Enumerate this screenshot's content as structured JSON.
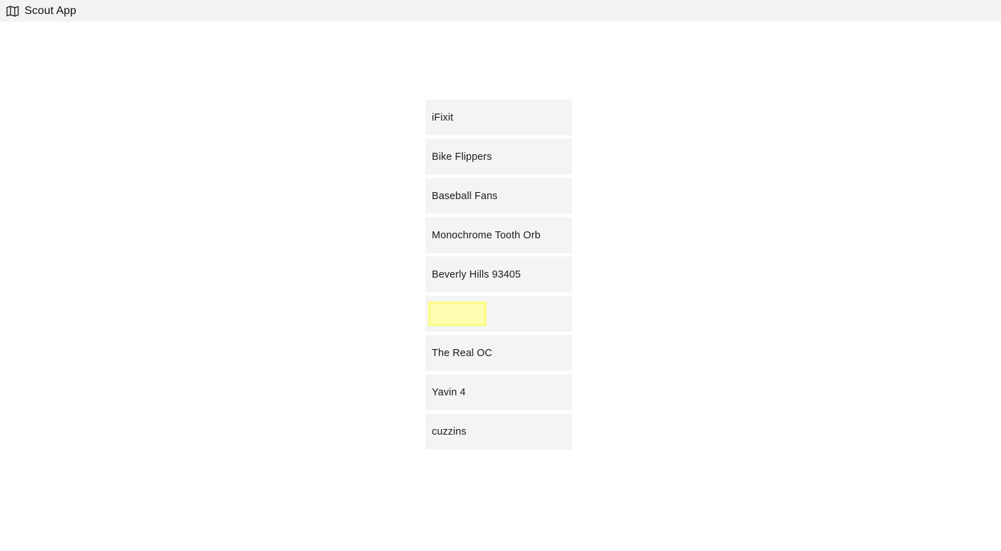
{
  "appbar": {
    "icon": "map-icon",
    "title": "Scout App"
  },
  "list": {
    "name": "scout-results-list",
    "items": [
      {
        "label": "iFixit",
        "highlighted": false
      },
      {
        "label": "Bike Flippers",
        "highlighted": false
      },
      {
        "label": "Baseball Fans",
        "highlighted": false
      },
      {
        "label": "Monochrome Tooth Orb",
        "highlighted": false
      },
      {
        "label": "Beverly Hills 93405",
        "highlighted": false
      },
      {
        "label": "",
        "highlighted": true
      },
      {
        "label": "The Real OC",
        "highlighted": false
      },
      {
        "label": "Yavin 4",
        "highlighted": false
      },
      {
        "label": "cuzzins",
        "highlighted": false
      }
    ]
  },
  "colors": {
    "appbar_background": "#f3f3f3",
    "page_background": "#ffffff",
    "item_background": "#f4f4f4",
    "item_text": "#1a1a1a",
    "highlight_fill": "#fdfdb0",
    "highlight_border": "#fbfb80"
  }
}
